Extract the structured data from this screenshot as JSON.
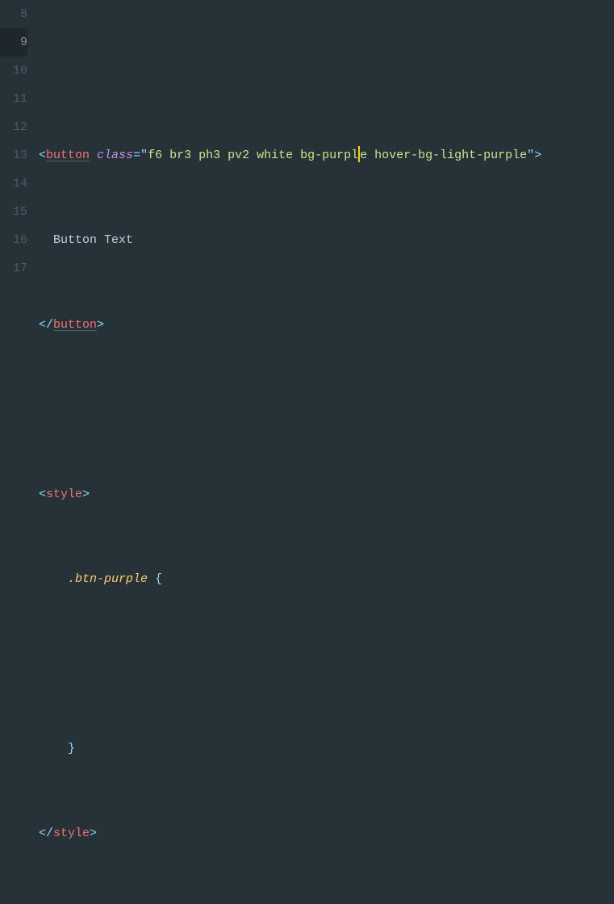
{
  "editor": {
    "activeLine": 9,
    "gutter": [
      "8",
      "9",
      "10",
      "11",
      "12",
      "13",
      "14",
      "15",
      "16",
      "17"
    ],
    "lines": {
      "l8": "",
      "l9": {
        "open": "<",
        "tag": "button",
        "sp1": " ",
        "attr": "class",
        "eq": "=",
        "q1": "\"",
        "strA": "f6 br3 ph3 pv2 white bg-purpl",
        "strB": "e hover-bg-light-purple",
        "q2": "\"",
        "close": ">"
      },
      "l10": "  Button Text",
      "l11": {
        "open": "</",
        "tag": "button",
        "close": ">"
      },
      "l12": "",
      "l13": {
        "open": "<",
        "tag": "style",
        "close": ">"
      },
      "l14": {
        "indent": "    ",
        "sel": ".btn-purple",
        "sp": " ",
        "brace": "{"
      },
      "l15": "",
      "l16": {
        "indent": "    ",
        "brace": "}"
      },
      "l17": {
        "open": "</",
        "tag": "style",
        "close": ">"
      }
    }
  }
}
